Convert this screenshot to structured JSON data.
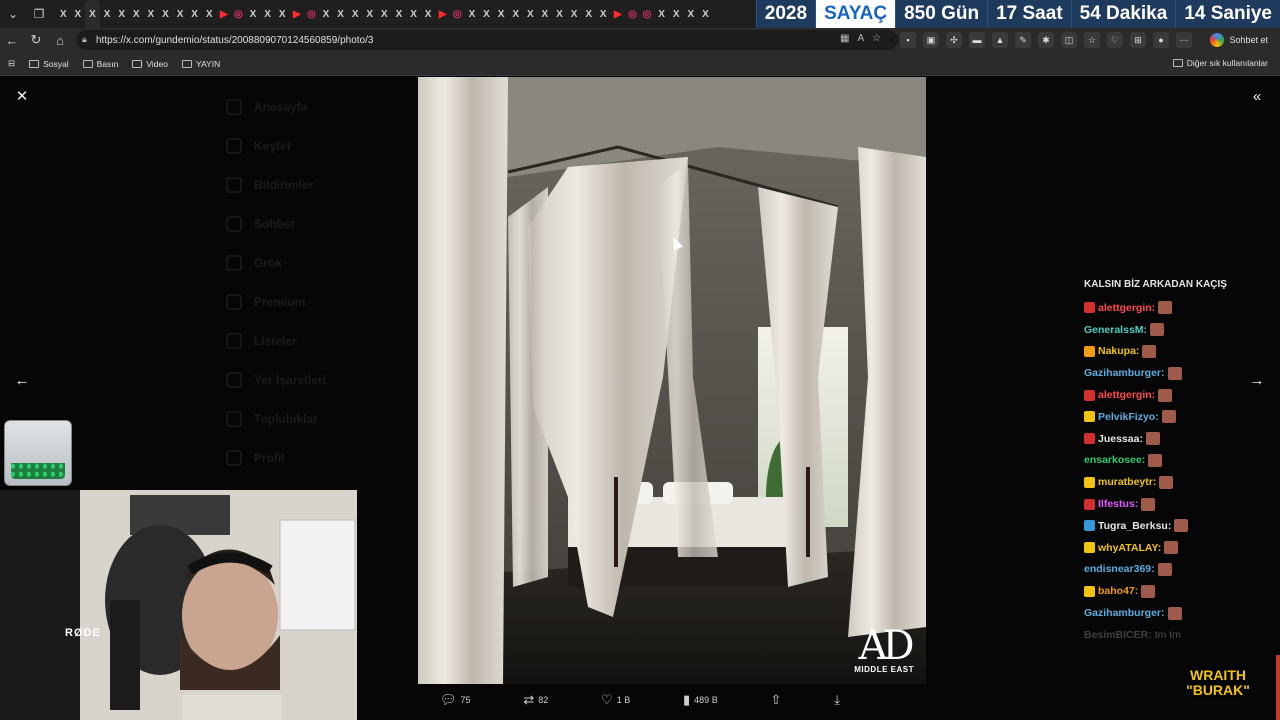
{
  "browser": {
    "tabs": [
      "X",
      "X",
      "X",
      "X",
      "X",
      "X",
      "X",
      "X",
      "X",
      "X",
      "X",
      "X",
      "X",
      "X",
      "X",
      "X",
      "X",
      "X",
      "X",
      "X",
      "X",
      "X",
      "X",
      "X",
      "X",
      "X",
      "X",
      "X",
      "X",
      "X",
      "X",
      "X",
      "X",
      "X",
      "X",
      "X",
      "X",
      "X",
      "X",
      "X",
      "X",
      "X",
      "X",
      "X",
      "X"
    ],
    "active_tab_label": "X",
    "url": "https://x.com/gundemio/status/2008809070124560859/photo/3",
    "chat_button": "Sohbet et",
    "bookmarks": [
      "Sosyal",
      "Basın",
      "Video",
      "YAYIN"
    ],
    "bookmarks_other": "Diğer sık kullanılanlar"
  },
  "counter": {
    "year": "2028",
    "label": "SAYAÇ",
    "days": "850 Gün",
    "hours": "17 Saat",
    "minutes": "54 Dakika",
    "seconds": "14 Saniye"
  },
  "viewer": {
    "logo_big": "AD",
    "logo_small": "MIDDLE EAST",
    "stats": {
      "replies": "75",
      "reposts": "82",
      "likes": "1 B",
      "views": "489 B"
    }
  },
  "background_sidebar": [
    "Anasayfa",
    "Keşfet",
    "Bildirimler",
    "Sohbet",
    "Grok",
    "Premium",
    "Listeler",
    "Yer İşaretleri",
    "Topluluklar",
    "Profil"
  ],
  "stream": {
    "mic_label": "RØDE",
    "brand_line1": "WRAITH",
    "brand_line2": "\"BURAK\"",
    "chat_header": "KALSIN BİZ ARKADAN KAÇIŞ",
    "chat": [
      {
        "user": "alettgergin:",
        "color": "#ff4b4b",
        "badge": "#d32f2f",
        "msg": ""
      },
      {
        "user": "GeneralssM:",
        "color": "#4ecdc4",
        "badge": "",
        "msg": ""
      },
      {
        "user": "Nakupa:",
        "color": "#f1c40f",
        "badge": "#f39c12",
        "msg": ""
      },
      {
        "user": "Gazihamburger:",
        "color": "#5dade2",
        "badge": "",
        "msg": ""
      },
      {
        "user": "alettgergin:",
        "color": "#ff4b4b",
        "badge": "#d32f2f",
        "msg": ""
      },
      {
        "user": "PelvikFizyo:",
        "color": "#5dade2",
        "badge": "#f1c40f",
        "msg": ""
      },
      {
        "user": "Juessaa:",
        "color": "#e6e6e6",
        "badge": "#d32f2f",
        "msg": ""
      },
      {
        "user": "ensarkosee:",
        "color": "#2ecc71",
        "badge": "",
        "msg": ""
      },
      {
        "user": "muratbeytr:",
        "color": "#f1c40f",
        "badge": "#f1c40f",
        "msg": ""
      },
      {
        "user": "Ilfestus:",
        "color": "#e056fd",
        "badge": "#d32f2f",
        "msg": ""
      },
      {
        "user": "Tugra_Berksu:",
        "color": "#e6e6e6",
        "badge": "#3498db",
        "msg": ""
      },
      {
        "user": "whyATALAY:",
        "color": "#f1c40f",
        "badge": "#f1c40f",
        "msg": ""
      },
      {
        "user": "endisnear369:",
        "color": "#5dade2",
        "badge": "",
        "msg": ""
      },
      {
        "user": "baho47:",
        "color": "#f39c12",
        "badge": "#f1c40f",
        "msg": ""
      },
      {
        "user": "Gazihamburger:",
        "color": "#5dade2",
        "badge": "",
        "msg": ""
      },
      {
        "user": "BesimBICER:",
        "color": "#aaaaaa",
        "badge": "",
        "msg": "tm tm"
      }
    ]
  }
}
